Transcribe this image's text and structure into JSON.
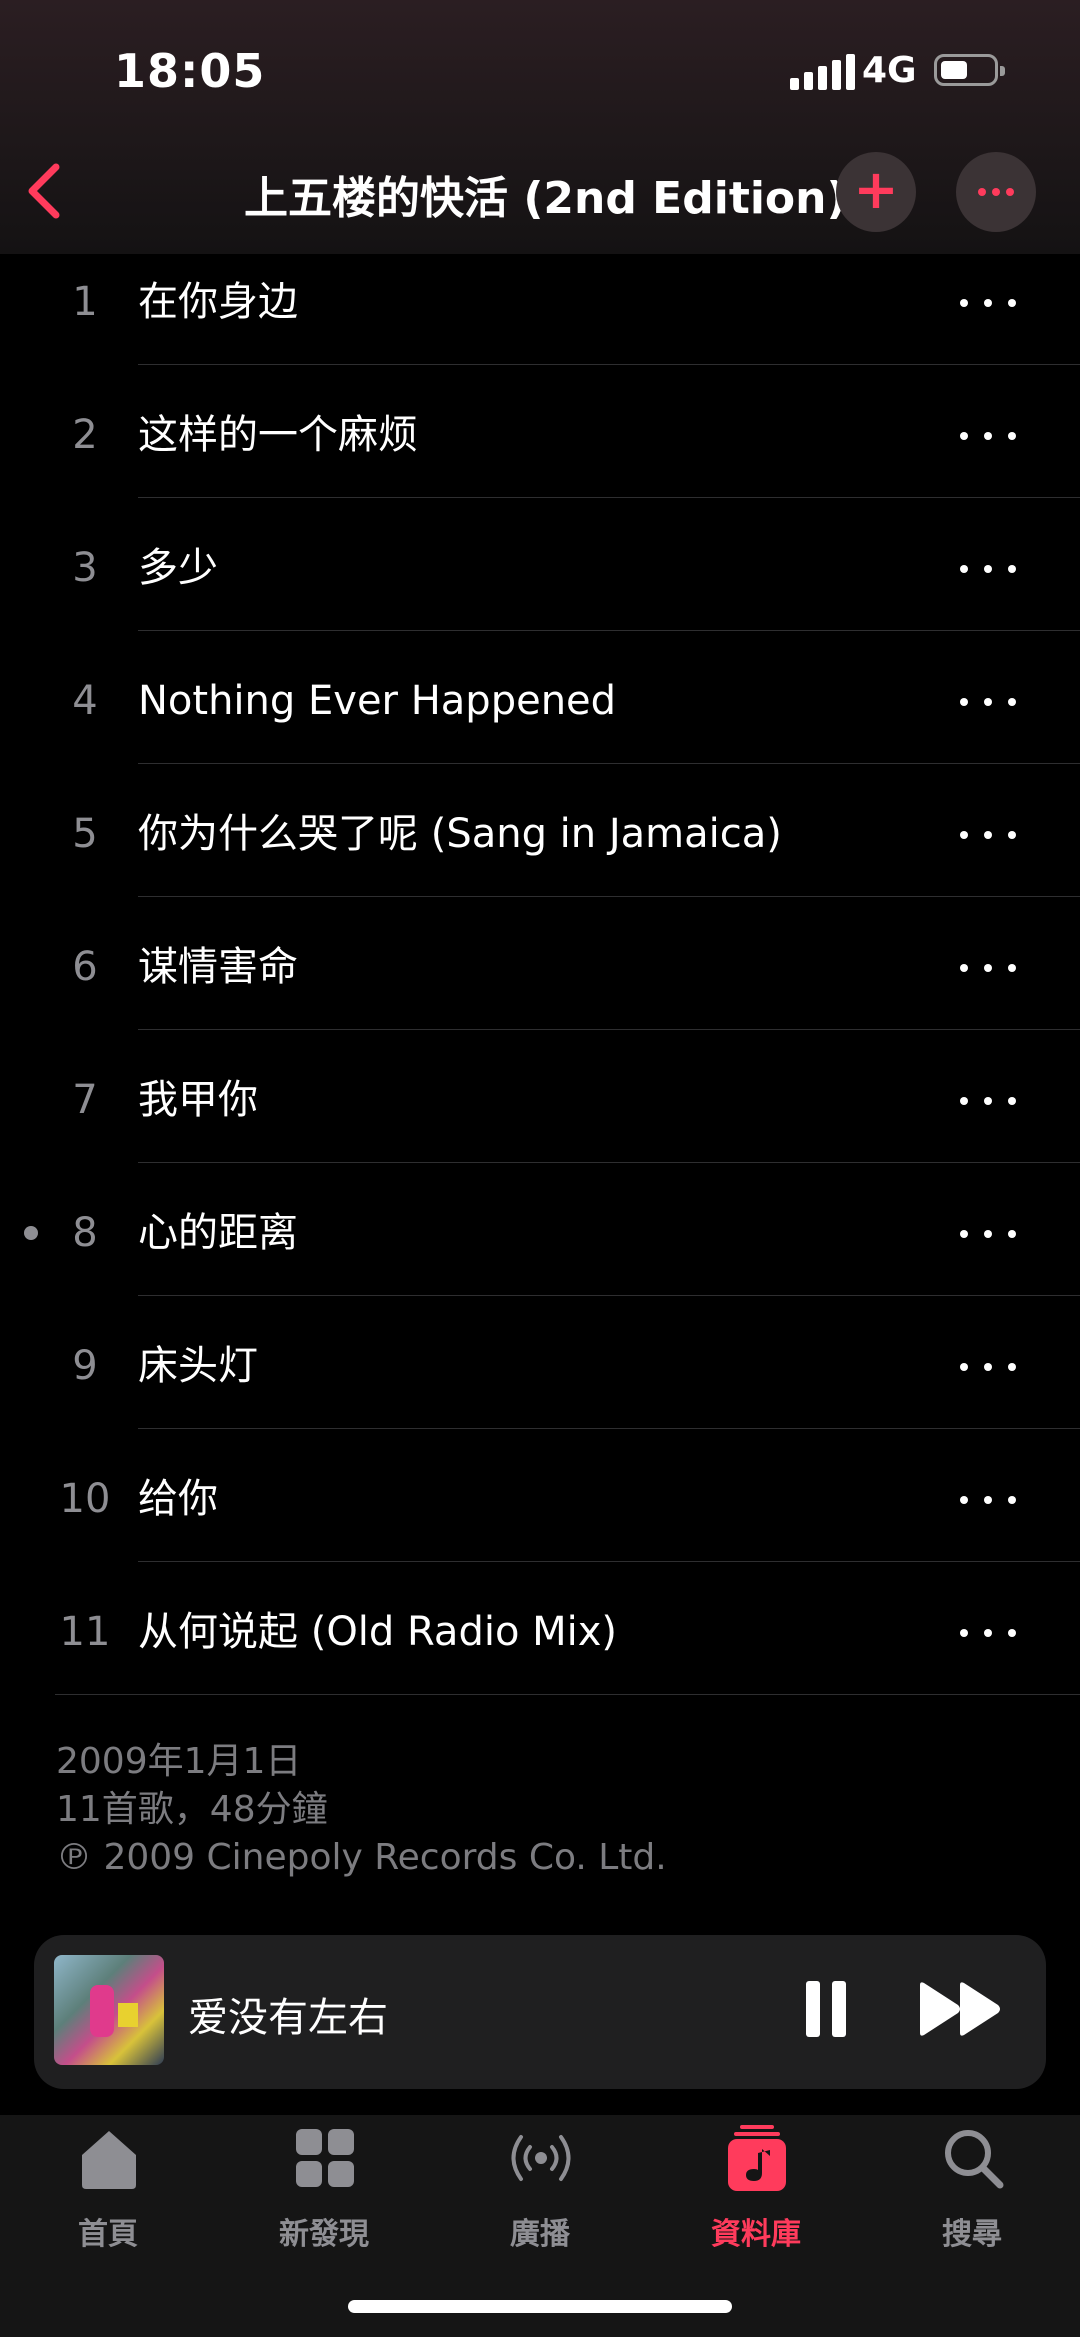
{
  "status_bar": {
    "time": "18:05",
    "network": "4G"
  },
  "header": {
    "title": "上五楼的快活 (2nd Edition)"
  },
  "tracks": [
    {
      "num": "1",
      "title": "在你身边"
    },
    {
      "num": "2",
      "title": "这样的一个麻烦"
    },
    {
      "num": "3",
      "title": "多少"
    },
    {
      "num": "4",
      "title": "Nothing Ever Happened"
    },
    {
      "num": "5",
      "title": "你为什么哭了呢 (Sang in Jamaica)"
    },
    {
      "num": "6",
      "title": "谋情害命"
    },
    {
      "num": "7",
      "title": "我甲你"
    },
    {
      "num": "8",
      "title": "心的距离"
    },
    {
      "num": "9",
      "title": "床头灯"
    },
    {
      "num": "10",
      "title": "给你"
    },
    {
      "num": "11",
      "title": "从何说起 (Old Radio Mix)"
    }
  ],
  "album_info": {
    "release_date": "2009年1月1日",
    "summary": "11首歌，48分鐘",
    "copyright": "℗ 2009 Cinepoly Records Co. Ltd."
  },
  "mini_player": {
    "title": "爱没有左右"
  },
  "tabs": [
    {
      "label": "首頁",
      "icon": "home-icon"
    },
    {
      "label": "新發現",
      "icon": "grid-icon"
    },
    {
      "label": "廣播",
      "icon": "radio-icon"
    },
    {
      "label": "資料庫",
      "icon": "library-icon"
    },
    {
      "label": "搜尋",
      "icon": "search-icon"
    }
  ],
  "colors": {
    "accent": "#ff3b5c",
    "secondary_text": "#8e8e93",
    "background": "#000000"
  }
}
